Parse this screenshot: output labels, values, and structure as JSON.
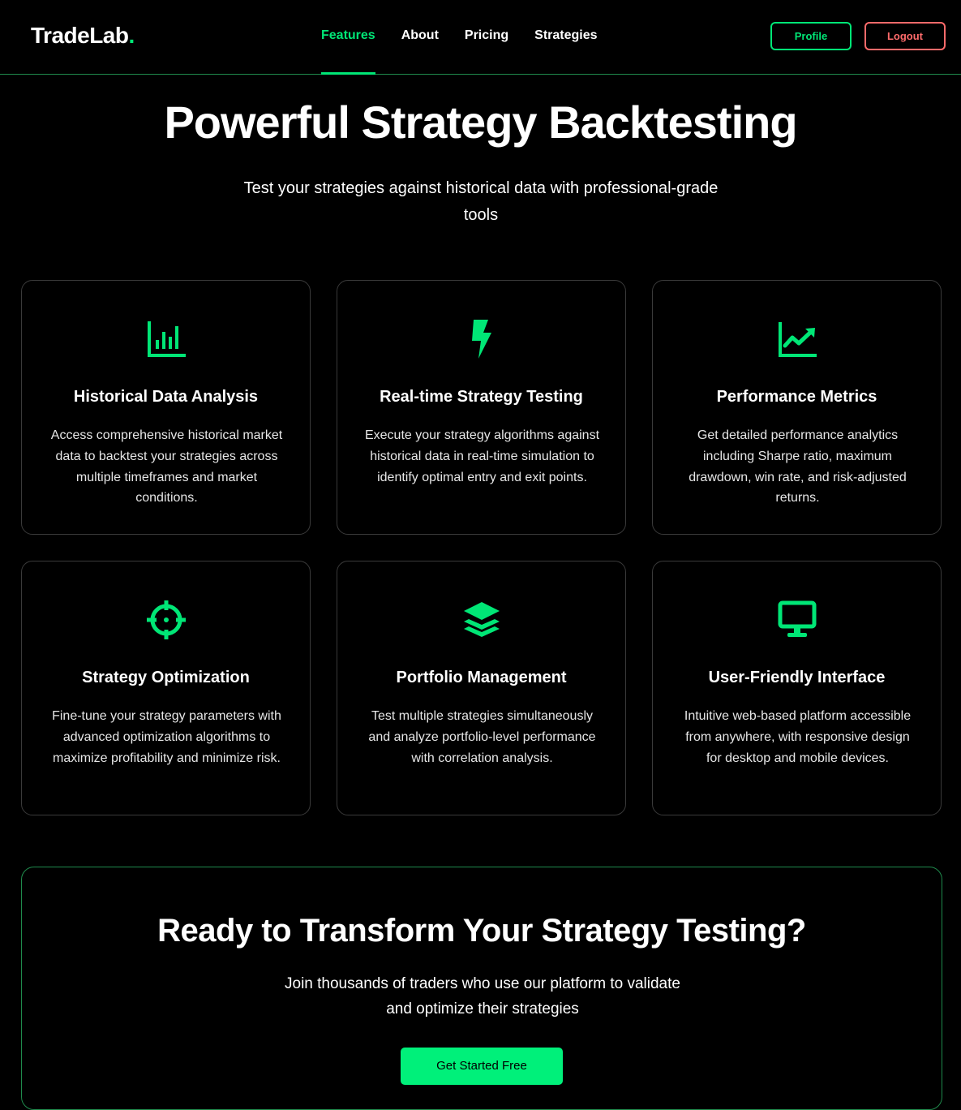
{
  "brand": {
    "name": "TradeLab",
    "dot": ".",
    "accent_color": "#00e676"
  },
  "nav": {
    "items": [
      {
        "label": "Features",
        "active": true
      },
      {
        "label": "About",
        "active": false
      },
      {
        "label": "Pricing",
        "active": false
      },
      {
        "label": "Strategies",
        "active": false
      }
    ],
    "profile_label": "Profile",
    "logout_label": "Logout",
    "logout_color": "#ff6b6b"
  },
  "hero": {
    "title": "Powerful Strategy Backtesting",
    "subtitle": "Test your strategies against historical data with professional-grade tools"
  },
  "features": [
    {
      "icon": "bar-chart-icon",
      "title": "Historical Data Analysis",
      "description": "Access comprehensive historical market data to backtest your strategies across multiple timeframes and market conditions."
    },
    {
      "icon": "lightning-bolt-icon",
      "title": "Real-time Strategy Testing",
      "description": "Execute your strategy algorithms against historical data in real-time simulation to identify optimal entry and exit points."
    },
    {
      "icon": "trending-up-chart-icon",
      "title": "Performance Metrics",
      "description": "Get detailed performance analytics including Sharpe ratio, maximum drawdown, win rate, and risk-adjusted returns."
    },
    {
      "icon": "crosshair-icon",
      "title": "Strategy Optimization",
      "description": "Fine-tune your strategy parameters with advanced optimization algorithms to maximize profitability and minimize risk."
    },
    {
      "icon": "layers-icon",
      "title": "Portfolio Management",
      "description": "Test multiple strategies simultaneously and analyze portfolio-level performance with correlation analysis."
    },
    {
      "icon": "desktop-monitor-icon",
      "title": "User-Friendly Interface",
      "description": "Intuitive web-based platform accessible from anywhere, with responsive design for desktop and mobile devices."
    }
  ],
  "cta": {
    "title": "Ready to Transform Your Strategy Testing?",
    "description": "Join thousands of traders who use our platform to validate and optimize their strategies",
    "button_label": "Get Started Free",
    "button_color": "#00f07a"
  }
}
